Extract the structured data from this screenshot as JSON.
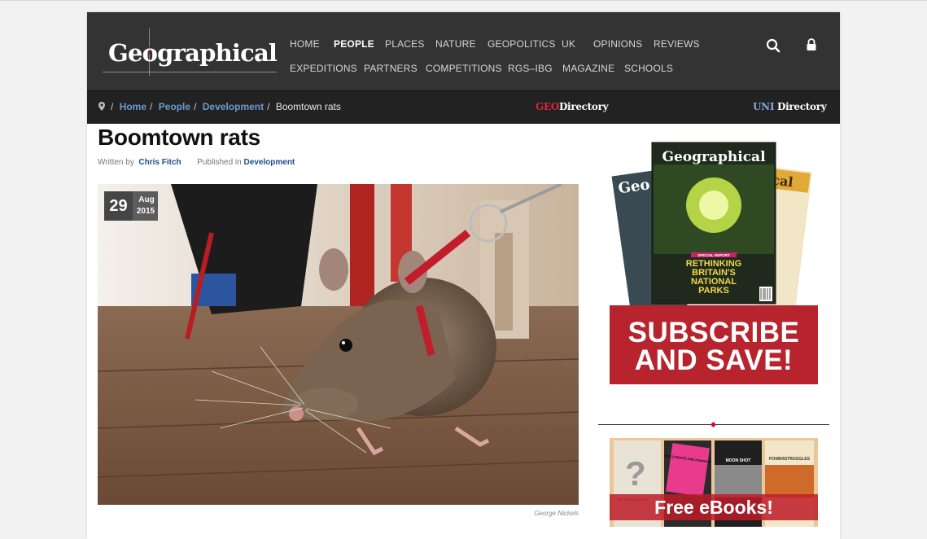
{
  "site": {
    "logo_text": "Geographical"
  },
  "nav": {
    "row1": [
      "HOME",
      "PEOPLE",
      "PLACES",
      "NATURE",
      "GEOPOLITICS",
      "UK",
      "OPINIONS",
      "REVIEWS"
    ],
    "row2": [
      "EXPEDITIONS",
      "PARTNERS",
      "COMPETITIONS",
      "RGS–IBG",
      "MAGAZINE",
      "SCHOOLS"
    ],
    "active": "PEOPLE"
  },
  "breadcrumb": {
    "items": [
      "Home",
      "People",
      "Development"
    ],
    "current": "Boomtown rats"
  },
  "directories": {
    "geo_prefix": "GEO",
    "geo_suffix": "Directory",
    "uni_prefix": "UNI",
    "uni_suffix": " Directory"
  },
  "article": {
    "title": "Boomtown rats",
    "written_by_label": "Written by",
    "author": "Chris Fitch",
    "published_label": "Published in",
    "category": "Development",
    "date_day": "29",
    "date_month": "Aug",
    "date_year": "2015",
    "photo_credit": "George Nickels"
  },
  "sidebar": {
    "magazine_masthead": "Geographical",
    "cover_headline": [
      "RETHINKING",
      "BRITAIN'S",
      "NATIONAL",
      "PARKS"
    ],
    "cover_special": "SPECIAL REPORT",
    "subscribe_line1": "SUBSCRIBE",
    "subscribe_line2": "AND SAVE!",
    "ebooks_label": "Free eBooks!",
    "ebook_titles": [
      "THE WORLD AFTER",
      "WOMEN'S RIGHTS ARE HUMAN RIGHTS",
      "MOON SHOT",
      "POWERSTRUGGLES"
    ]
  },
  "colors": {
    "header_bg": "#333333",
    "crumb_bg": "#222222",
    "link_blue": "#6b9bd2",
    "brand_red": "#b7242d"
  }
}
